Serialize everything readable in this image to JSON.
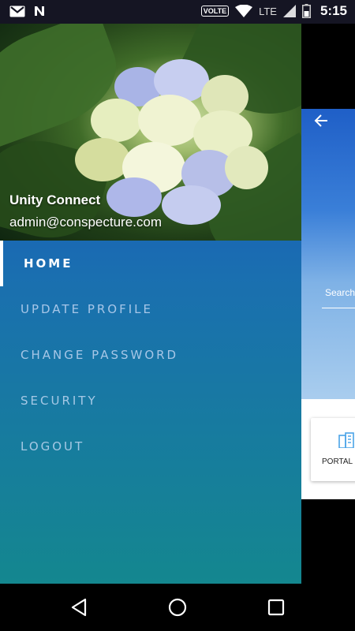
{
  "status_bar": {
    "network_badge": "VOLTE",
    "lte_label": "LTE",
    "time": "5:15",
    "left_icons": [
      "gmail-icon",
      "notification-n-icon"
    ],
    "right_icons": [
      "wifi-icon",
      "signal-icon",
      "battery-icon"
    ]
  },
  "drawer": {
    "user": {
      "name": "Unity Connect",
      "email": "admin@conspecture.com"
    },
    "menu": [
      {
        "label": "HOME",
        "active": true
      },
      {
        "label": "UPDATE PROFILE",
        "active": false
      },
      {
        "label": "CHANGE PASSWORD",
        "active": false
      },
      {
        "label": "SECURITY",
        "active": false
      },
      {
        "label": "LOGOUT",
        "active": false
      }
    ]
  },
  "main_screen": {
    "search_placeholder": "Search",
    "card_label": "PORTAL I"
  },
  "colors": {
    "drawer_top": "#1d46c4",
    "drawer_bottom": "#14878f",
    "status_bar": "#151523"
  }
}
